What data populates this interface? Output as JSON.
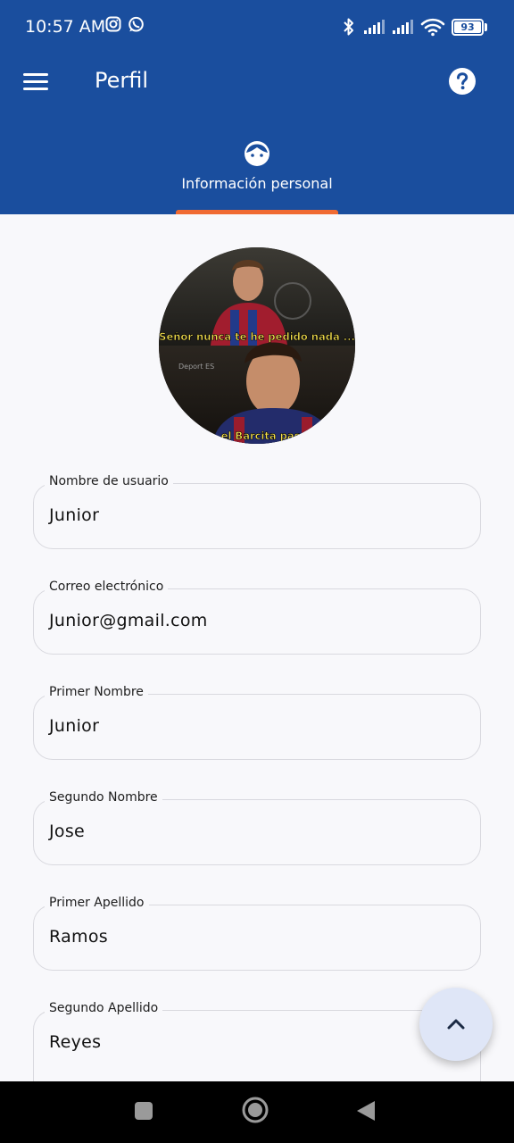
{
  "status_bar": {
    "time": "10:57 AM",
    "battery": "93"
  },
  "app_bar": {
    "title": "Perfil"
  },
  "tabs": [
    {
      "label": "Información personal",
      "icon": "face-icon",
      "active": true
    }
  ],
  "avatar": {
    "caption_top": "Señor nunca te he pedido nada ...",
    "watermark": "Deport ES",
    "caption_bottom": "el Barcita pase"
  },
  "form": {
    "fields": [
      {
        "label": "Nombre de usuario",
        "value": "Junior"
      },
      {
        "label": "Correo electrónico",
        "value": "Junior@gmail.com"
      },
      {
        "label": "Primer Nombre",
        "value": "Junior"
      },
      {
        "label": "Segundo Nombre",
        "value": "Jose"
      },
      {
        "label": "Primer Apellido",
        "value": "Ramos"
      },
      {
        "label": "Segundo Apellido",
        "value": "Reyes"
      }
    ]
  },
  "colors": {
    "app_bar": "#1a4e9e",
    "tab_indicator": "#f06a32",
    "background": "#f8f8fb",
    "fab": "#dfe6f7"
  }
}
